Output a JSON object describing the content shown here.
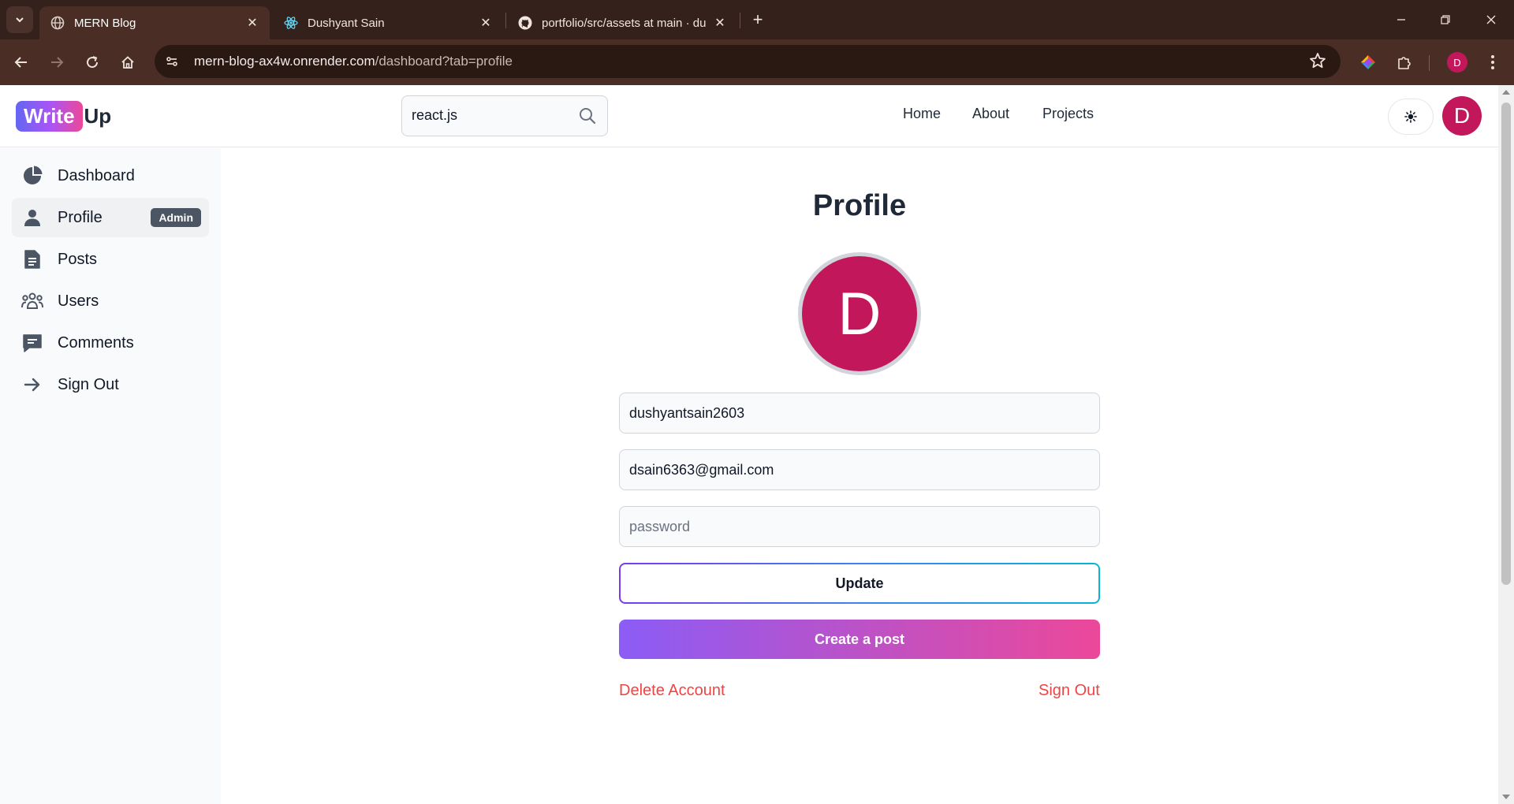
{
  "browser": {
    "tabs": [
      {
        "title": "MERN Blog",
        "active": true,
        "icon": "globe-icon"
      },
      {
        "title": "Dushyant Sain",
        "active": false,
        "icon": "react-icon"
      },
      {
        "title": "portfolio/src/assets at main · du",
        "active": false,
        "icon": "github-icon"
      }
    ],
    "url_host": "mern-blog-ax4w.onrender.com",
    "url_path": "/dashboard?tab=profile",
    "profile_initial": "D"
  },
  "header": {
    "logo_badge": "Write",
    "logo_rest": "Up",
    "search_value": "react.js",
    "nav": {
      "home": "Home",
      "about": "About",
      "projects": "Projects"
    },
    "avatar_initial": "D"
  },
  "sidebar": {
    "items": [
      {
        "label": "Dashboard",
        "icon": "pie-chart-icon"
      },
      {
        "label": "Profile",
        "icon": "user-icon",
        "badge": "Admin",
        "active": true
      },
      {
        "label": "Posts",
        "icon": "document-icon"
      },
      {
        "label": "Users",
        "icon": "users-icon"
      },
      {
        "label": "Comments",
        "icon": "comment-icon"
      },
      {
        "label": "Sign Out",
        "icon": "arrow-right-icon"
      }
    ]
  },
  "profile": {
    "title": "Profile",
    "avatar_initial": "D",
    "username": "dushyantsain2603",
    "email": "dsain6363@gmail.com",
    "password_placeholder": "password",
    "update_label": "Update",
    "create_post_label": "Create a post",
    "delete_label": "Delete Account",
    "signout_label": "Sign Out"
  },
  "colors": {
    "avatar": "#c2185b",
    "danger": "#ef4444",
    "gradient_start": "#8b5cf6",
    "gradient_end": "#ec4899"
  }
}
